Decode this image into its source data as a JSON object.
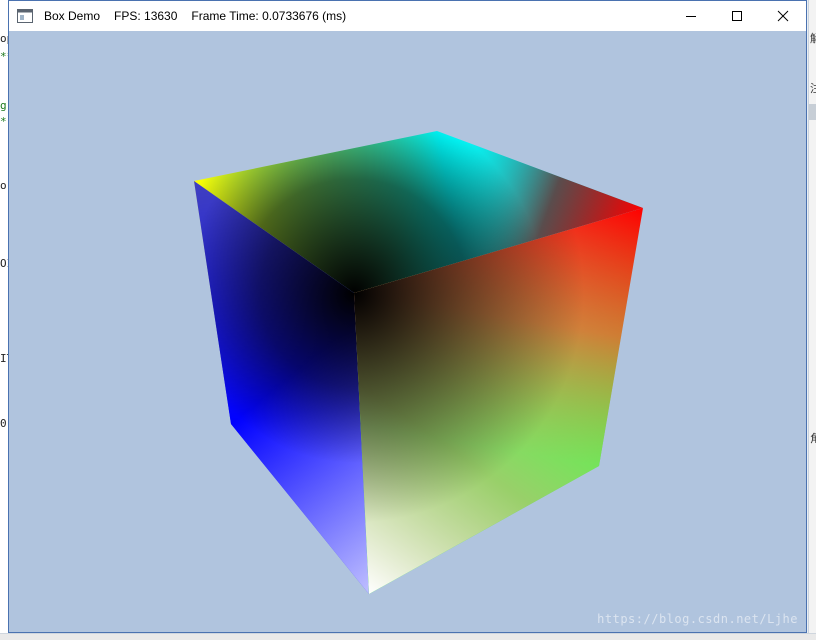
{
  "window": {
    "title": "Box Demo",
    "fps_text": "FPS: 13630",
    "frame_time_text": "Frame Time: 0.0733676 (ms)",
    "icon": "app-window-icon",
    "controls": {
      "minimize_icon": "minimize-icon",
      "maximize_icon": "maximize-icon",
      "close_icon": "close-icon"
    }
  },
  "scene": {
    "background_color": "#b0c4de",
    "cube_colors": {
      "white": "#ffffff",
      "black": "#000000",
      "red": "#ff0000",
      "green": "#00ff00",
      "blue": "#0000ff",
      "yellow": "#ffff00",
      "cyan": "#00ffff",
      "magenta": "#ff00ff"
    }
  },
  "watermark": "https://blog.csdn.net/Ljhe",
  "background_editor": {
    "left_fragments": [
      "op",
      "**",
      "g",
      "*",
      "o",
      "OI",
      "IT",
      "0"
    ],
    "right_fragments": [
      "解",
      "注",
      "角"
    ]
  }
}
